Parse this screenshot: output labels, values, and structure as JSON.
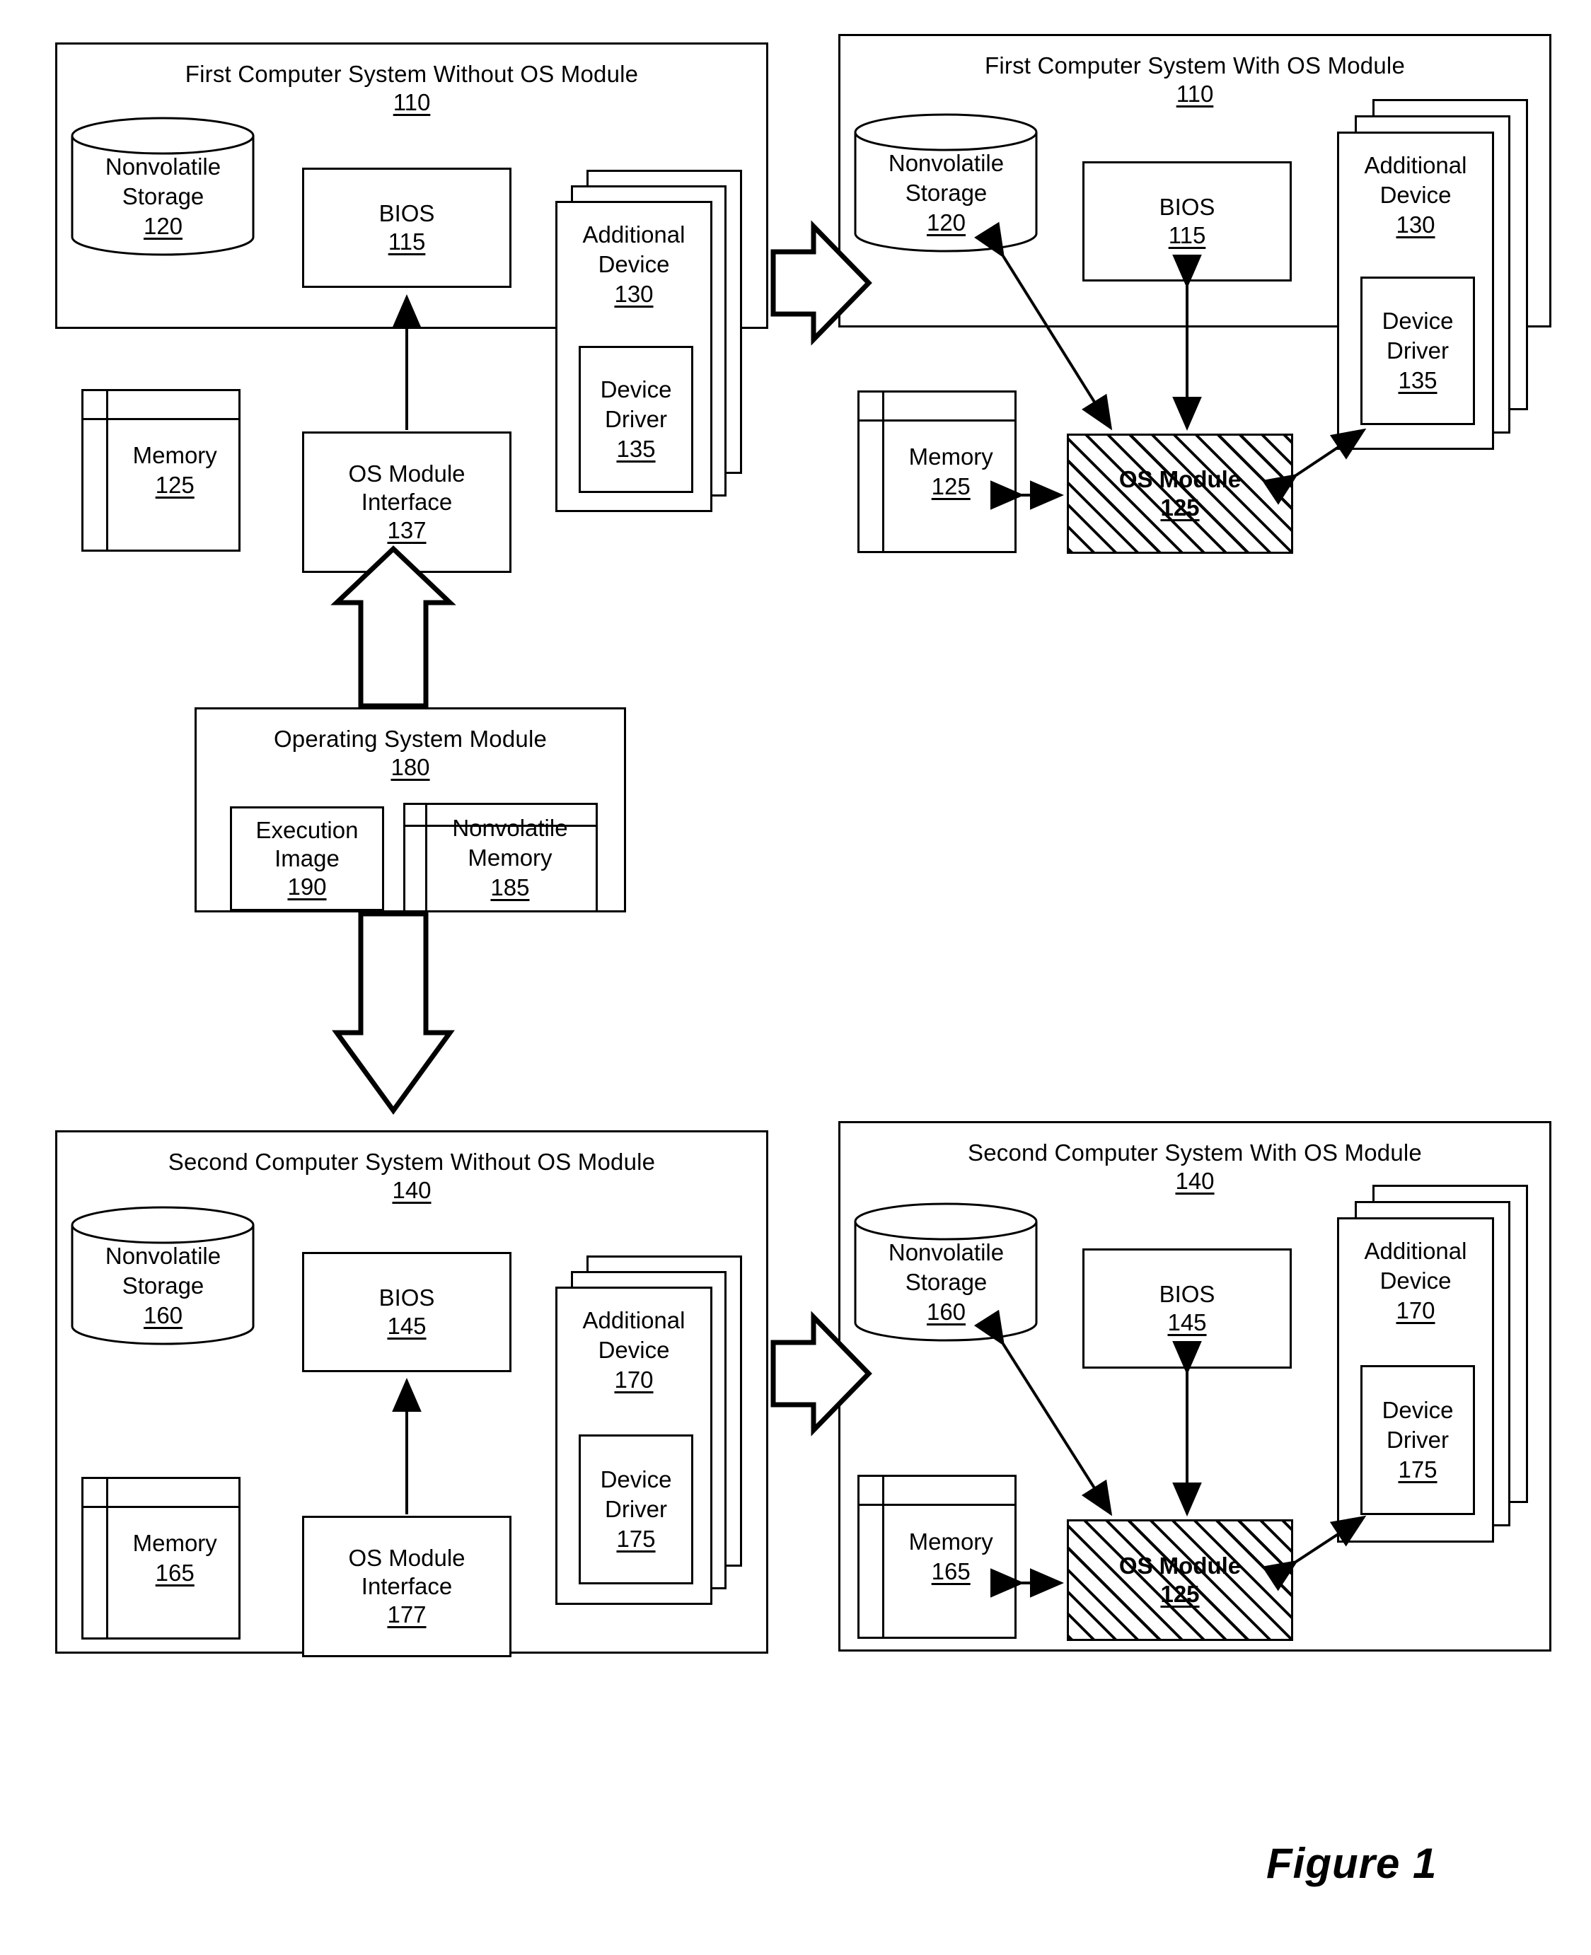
{
  "figure": {
    "caption": "Figure 1"
  },
  "systems": [
    {
      "id": "first-without",
      "title": "First Computer System Without OS Module",
      "number": "110",
      "storage": {
        "line1": "Nonvolatile",
        "line2": "Storage",
        "number": "120"
      },
      "bios": {
        "label": "BIOS",
        "number": "115"
      },
      "memory": {
        "label": "Memory",
        "number": "125"
      },
      "interface": {
        "line1": "OS Module",
        "line2": "Interface",
        "number": "137"
      },
      "device": {
        "line1": "Additional",
        "line2": "Device",
        "number": "130"
      },
      "driver": {
        "line1": "Device",
        "line2": "Driver",
        "number": "135"
      }
    },
    {
      "id": "first-with",
      "title": "First Computer System With OS Module",
      "number": "110",
      "storage": {
        "line1": "Nonvolatile",
        "line2": "Storage",
        "number": "120"
      },
      "bios": {
        "label": "BIOS",
        "number": "115"
      },
      "memory": {
        "label": "Memory",
        "number": "125"
      },
      "osmodule": {
        "label": "OS Module",
        "number": "125"
      },
      "device": {
        "line1": "Additional",
        "line2": "Device",
        "number": "130"
      },
      "driver": {
        "line1": "Device",
        "line2": "Driver",
        "number": "135"
      }
    },
    {
      "id": "second-without",
      "title": "Second Computer System Without OS Module",
      "number": "140",
      "storage": {
        "line1": "Nonvolatile",
        "line2": "Storage",
        "number": "160"
      },
      "bios": {
        "label": "BIOS",
        "number": "145"
      },
      "memory": {
        "label": "Memory",
        "number": "165"
      },
      "interface": {
        "line1": "OS Module",
        "line2": "Interface",
        "number": "177"
      },
      "device": {
        "line1": "Additional",
        "line2": "Device",
        "number": "170"
      },
      "driver": {
        "line1": "Device",
        "line2": "Driver",
        "number": "175"
      }
    },
    {
      "id": "second-with",
      "title": "Second Computer System With OS Module",
      "number": "140",
      "storage": {
        "line1": "Nonvolatile",
        "line2": "Storage",
        "number": "160"
      },
      "bios": {
        "label": "BIOS",
        "number": "145"
      },
      "memory": {
        "label": "Memory",
        "number": "165"
      },
      "osmodule": {
        "label": "OS Module",
        "number": "125"
      },
      "device": {
        "line1": "Additional",
        "line2": "Device",
        "number": "170"
      },
      "driver": {
        "line1": "Device",
        "line2": "Driver",
        "number": "175"
      }
    }
  ],
  "os_module_source": {
    "title": "Operating System Module",
    "number": "180",
    "execution_image": {
      "line1": "Execution",
      "line2": "Image",
      "number": "190"
    },
    "nonvolatile_memory": {
      "line1": "Nonvolatile",
      "line2": "Memory",
      "number": "185"
    }
  },
  "colors": {
    "ink": "#000000",
    "paper": "#ffffff"
  }
}
